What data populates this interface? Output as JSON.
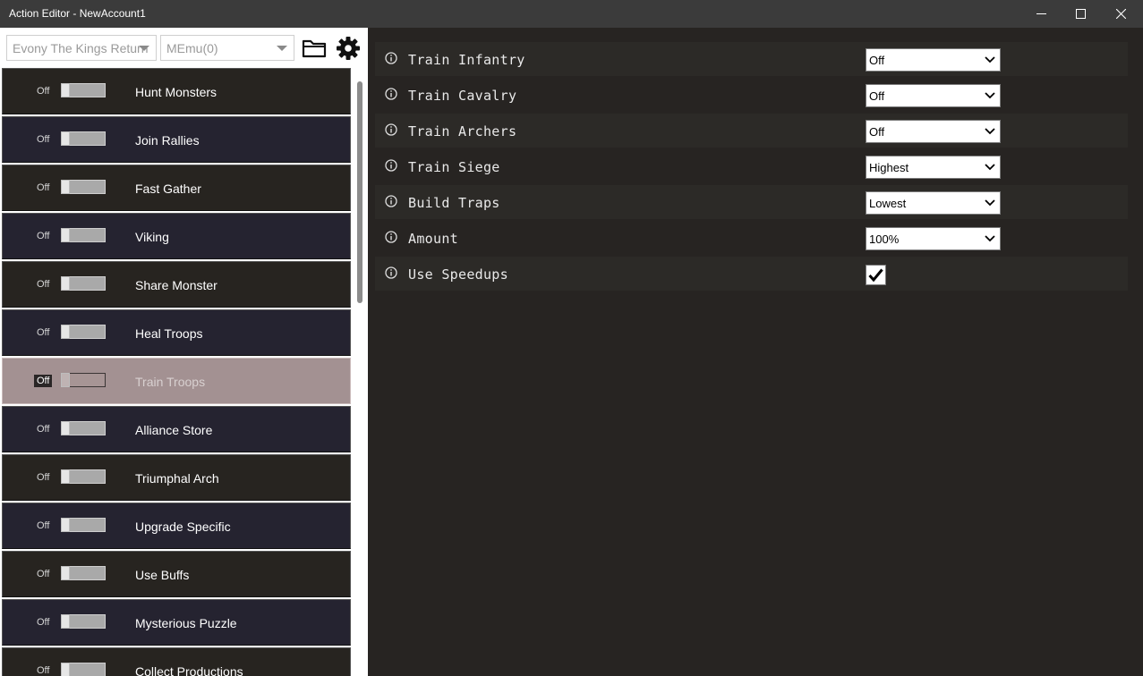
{
  "window": {
    "title": "Action Editor - NewAccount1"
  },
  "toolbar": {
    "game_select": "Evony The Kings Return",
    "emulator_select": "MEmu(0)",
    "folder_icon": "folder-icon",
    "settings_icon": "gear-icon"
  },
  "actions": [
    {
      "label": "Hunt Monsters",
      "state": "Off"
    },
    {
      "label": "Join Rallies",
      "state": "Off"
    },
    {
      "label": "Fast Gather",
      "state": "Off"
    },
    {
      "label": "Viking",
      "state": "Off"
    },
    {
      "label": "Share Monster",
      "state": "Off"
    },
    {
      "label": "Heal Troops",
      "state": "Off"
    },
    {
      "label": "Train Troops",
      "state": "Off",
      "selected": true
    },
    {
      "label": "Alliance Store",
      "state": "Off"
    },
    {
      "label": "Triumphal Arch",
      "state": "Off"
    },
    {
      "label": "Upgrade Specific",
      "state": "Off"
    },
    {
      "label": "Use Buffs",
      "state": "Off"
    },
    {
      "label": "Mysterious Puzzle",
      "state": "Off"
    },
    {
      "label": "Collect Productions",
      "state": "Off"
    }
  ],
  "settings": [
    {
      "label": "Train Infantry",
      "type": "select",
      "value": "Off"
    },
    {
      "label": "Train Cavalry",
      "type": "select",
      "value": "Off"
    },
    {
      "label": "Train Archers",
      "type": "select",
      "value": "Off"
    },
    {
      "label": "Train Siege",
      "type": "select",
      "value": "Highest"
    },
    {
      "label": "Build Traps",
      "type": "select",
      "value": "Lowest"
    },
    {
      "label": "Amount",
      "type": "select",
      "value": "100%"
    },
    {
      "label": "Use Speedups",
      "type": "checkbox",
      "checked": true
    }
  ],
  "colors": {
    "selected_item_bg": "#a39192",
    "panel_bg": "#272422",
    "titlebar_bg": "#3b3b3b"
  }
}
